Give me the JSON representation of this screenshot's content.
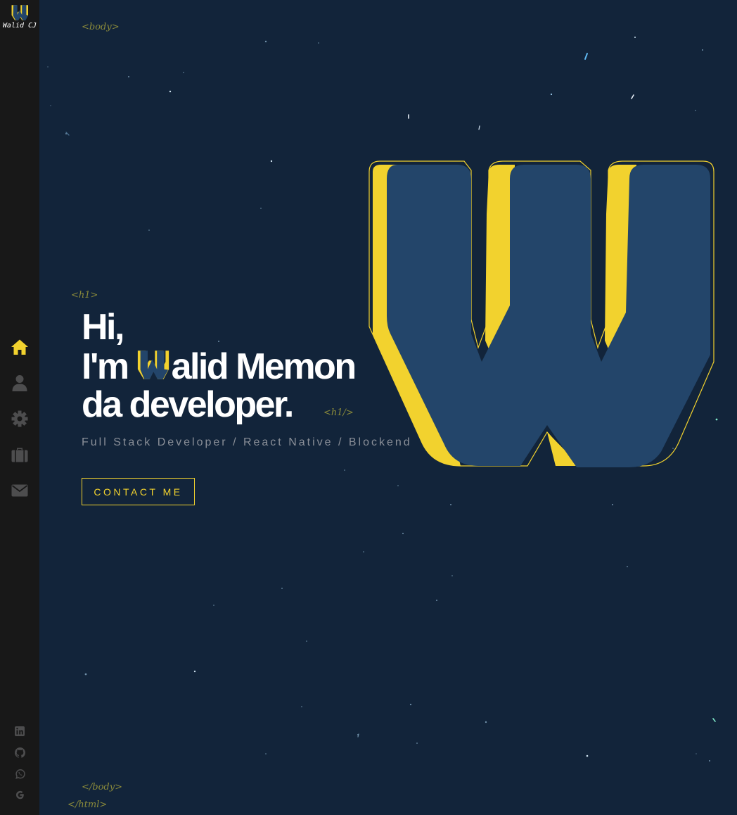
{
  "sidebar": {
    "logo_text": "Walid CJ",
    "nav": [
      {
        "name": "home",
        "icon": "home-icon",
        "active": true
      },
      {
        "name": "about",
        "icon": "user-icon",
        "active": false
      },
      {
        "name": "skills",
        "icon": "gear-icon",
        "active": false
      },
      {
        "name": "work",
        "icon": "briefcase-icon",
        "active": false
      },
      {
        "name": "contact",
        "icon": "envelope-icon",
        "active": false
      }
    ],
    "social": [
      {
        "name": "linkedin",
        "icon": "linkedin-icon"
      },
      {
        "name": "github",
        "icon": "github-icon"
      },
      {
        "name": "whatsapp",
        "icon": "whatsapp-icon"
      },
      {
        "name": "google",
        "icon": "google-icon"
      }
    ]
  },
  "tags": {
    "body_open": "<body>",
    "h1_open": "<h1>",
    "h1_close": "<h1/>",
    "body_close": "</body>",
    "html_close": "</html>"
  },
  "hero": {
    "line1": "Hi,",
    "line2_prefix": "I'm",
    "line2_rest": "alid Memon",
    "line3": "da developer.",
    "subtitle": "Full Stack Developer / React Native / Blockend",
    "contact_label": "CONTACT ME"
  },
  "colors": {
    "background": "#12243a",
    "sidebar": "#181818",
    "accent": "#f2d22e",
    "logo_blue": "#23456a",
    "muted": "#8a8f98",
    "icon_inactive": "#4d4d4e"
  }
}
